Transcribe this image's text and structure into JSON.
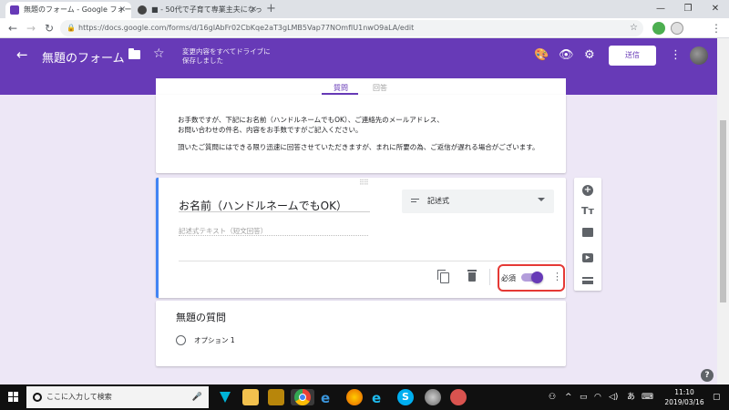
{
  "browser": {
    "tabs": [
      {
        "label": "無題のフォーム - Google フォーム",
        "active": true
      },
      {
        "label": "■ - 50代で子育て専業主夫になっ…",
        "active": false
      }
    ],
    "new_tab": "+",
    "window_controls": {
      "minimize": "—",
      "maximize": "❐",
      "close": "✕"
    },
    "url": "https://docs.google.com/forms/d/16gIAbFr02CbKqe2aT3gLMB5Vap77NOmfIU1nwO9aLA/edit"
  },
  "form_header": {
    "back": "←",
    "title": "無題のフォーム",
    "saved_status": "変更内容をすべてドライブに保存しました",
    "send_button": "送信",
    "tabs": [
      {
        "label": "質問",
        "active": true
      },
      {
        "label": "回答",
        "active": false
      }
    ],
    "accent_color": "#673ab7"
  },
  "description": {
    "lines": [
      "お手数ですが、下記にお名前（ハンドルネームでもOK）、ご連絡先のメールアドレス、",
      "お問い合わせの件名、内容をお手数ですがご記入ください。",
      "頂いたご質問にはできる限り迅速に回答させていただきますが、まれに所要の為、ご返信が遅れる場合がございます。"
    ]
  },
  "active_question": {
    "title": "お名前（ハンドルネームでもOK）",
    "type_label": "記述式",
    "answer_placeholder": "記述式テキスト（短文回答）",
    "required_label": "必須",
    "required_on": true
  },
  "question2": {
    "title": "無題の質問",
    "option": "オプション 1"
  },
  "toolbar": {
    "items": [
      "add-question-icon",
      "title-text-icon",
      "image-icon",
      "video-icon",
      "section-icon"
    ],
    "title_glyph": "Tт"
  },
  "help": "?",
  "taskbar": {
    "search_placeholder": "ここに入力して検索",
    "time": "11:10",
    "date": "2019/03/16",
    "ime": "あ"
  }
}
